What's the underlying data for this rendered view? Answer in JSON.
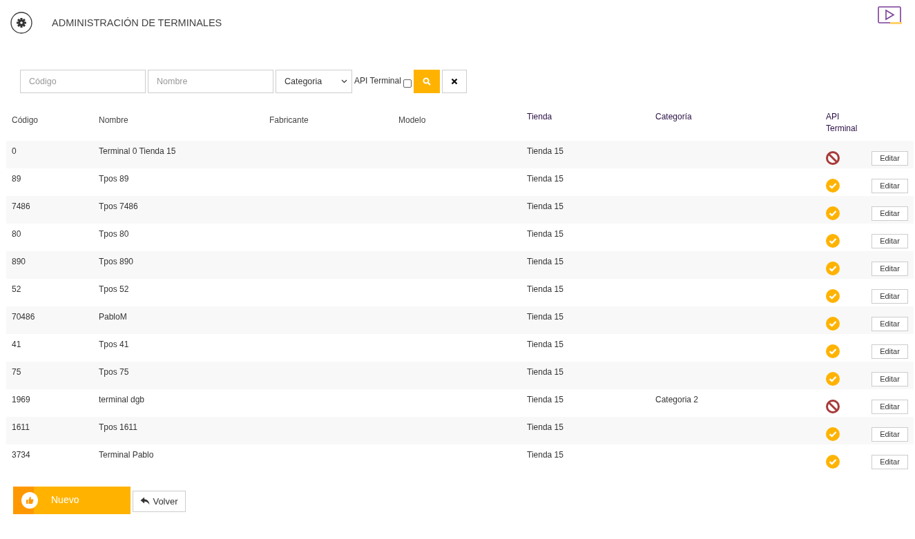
{
  "header": {
    "title": "ADMINISTRACIÓN DE TERMINALES"
  },
  "filters": {
    "code": {
      "placeholder": "Código"
    },
    "name": {
      "placeholder": "Nombre"
    },
    "category": {
      "value": "Categoria"
    },
    "api_label": "API Terminal",
    "api_checked": false
  },
  "table": {
    "columns": [
      {
        "label": "Código",
        "sortable": false
      },
      {
        "label": "Nombre",
        "sortable": false
      },
      {
        "label": "Fabricante",
        "sortable": false
      },
      {
        "label": "Modelo",
        "sortable": false
      },
      {
        "label": "Tienda",
        "sortable": true
      },
      {
        "label": "Categoría",
        "sortable": true
      },
      {
        "label": "API Terminal",
        "sortable": true
      }
    ],
    "rows": [
      {
        "code": "0",
        "name": "Terminal 0 Tienda 15",
        "store": "Tienda 15",
        "category": "",
        "api": false,
        "action": "Editar"
      },
      {
        "code": "89",
        "name": "Tpos 89",
        "store": "Tienda 15",
        "category": "",
        "api": true,
        "action": "Editar"
      },
      {
        "code": "7486",
        "name": "Tpos 7486",
        "store": "Tienda 15",
        "category": "",
        "api": true,
        "action": "Editar"
      },
      {
        "code": "80",
        "name": "Tpos 80",
        "store": "Tienda 15",
        "category": "",
        "api": true,
        "action": "Editar"
      },
      {
        "code": "890",
        "name": "Tpos 890",
        "store": "Tienda 15",
        "category": "",
        "api": true,
        "action": "Editar"
      },
      {
        "code": "52",
        "name": "Tpos 52",
        "store": "Tienda 15",
        "category": "",
        "api": true,
        "action": "Editar"
      },
      {
        "code": "70486",
        "name": "PabloM",
        "store": "Tienda 15",
        "category": "",
        "api": true,
        "action": "Editar"
      },
      {
        "code": "41",
        "name": "Tpos 41",
        "store": "Tienda 15",
        "category": "",
        "api": true,
        "action": "Editar"
      },
      {
        "code": "75",
        "name": "Tpos 75",
        "store": "Tienda 15",
        "category": "",
        "api": true,
        "action": "Editar"
      },
      {
        "code": "1969",
        "name": "terminal dgb",
        "store": "Tienda 15",
        "category": "Categoria 2",
        "api": false,
        "action": "Editar"
      },
      {
        "code": "1611",
        "name": "Tpos 1611",
        "store": "Tienda 15",
        "category": "",
        "api": true,
        "action": "Editar"
      },
      {
        "code": "3734",
        "name": "Terminal Pablo",
        "store": "Tienda 15",
        "category": "",
        "api": true,
        "action": "Editar"
      }
    ]
  },
  "footer": {
    "new_button": "Nuevo",
    "back_button": "Volver"
  }
}
